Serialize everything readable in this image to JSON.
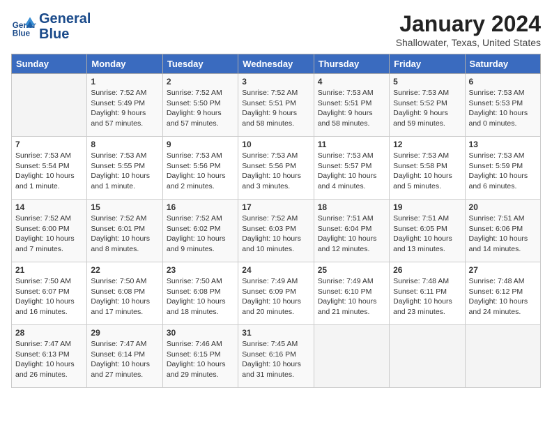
{
  "header": {
    "logo_line1": "General",
    "logo_line2": "Blue",
    "month": "January 2024",
    "location": "Shallowater, Texas, United States"
  },
  "days_of_week": [
    "Sunday",
    "Monday",
    "Tuesday",
    "Wednesday",
    "Thursday",
    "Friday",
    "Saturday"
  ],
  "weeks": [
    [
      {
        "day": "",
        "info": ""
      },
      {
        "day": "1",
        "info": "Sunrise: 7:52 AM\nSunset: 5:49 PM\nDaylight: 9 hours\nand 57 minutes."
      },
      {
        "day": "2",
        "info": "Sunrise: 7:52 AM\nSunset: 5:50 PM\nDaylight: 9 hours\nand 57 minutes."
      },
      {
        "day": "3",
        "info": "Sunrise: 7:52 AM\nSunset: 5:51 PM\nDaylight: 9 hours\nand 58 minutes."
      },
      {
        "day": "4",
        "info": "Sunrise: 7:53 AM\nSunset: 5:51 PM\nDaylight: 9 hours\nand 58 minutes."
      },
      {
        "day": "5",
        "info": "Sunrise: 7:53 AM\nSunset: 5:52 PM\nDaylight: 9 hours\nand 59 minutes."
      },
      {
        "day": "6",
        "info": "Sunrise: 7:53 AM\nSunset: 5:53 PM\nDaylight: 10 hours\nand 0 minutes."
      }
    ],
    [
      {
        "day": "7",
        "info": "Sunrise: 7:53 AM\nSunset: 5:54 PM\nDaylight: 10 hours\nand 1 minute."
      },
      {
        "day": "8",
        "info": "Sunrise: 7:53 AM\nSunset: 5:55 PM\nDaylight: 10 hours\nand 1 minute."
      },
      {
        "day": "9",
        "info": "Sunrise: 7:53 AM\nSunset: 5:56 PM\nDaylight: 10 hours\nand 2 minutes."
      },
      {
        "day": "10",
        "info": "Sunrise: 7:53 AM\nSunset: 5:56 PM\nDaylight: 10 hours\nand 3 minutes."
      },
      {
        "day": "11",
        "info": "Sunrise: 7:53 AM\nSunset: 5:57 PM\nDaylight: 10 hours\nand 4 minutes."
      },
      {
        "day": "12",
        "info": "Sunrise: 7:53 AM\nSunset: 5:58 PM\nDaylight: 10 hours\nand 5 minutes."
      },
      {
        "day": "13",
        "info": "Sunrise: 7:53 AM\nSunset: 5:59 PM\nDaylight: 10 hours\nand 6 minutes."
      }
    ],
    [
      {
        "day": "14",
        "info": "Sunrise: 7:52 AM\nSunset: 6:00 PM\nDaylight: 10 hours\nand 7 minutes."
      },
      {
        "day": "15",
        "info": "Sunrise: 7:52 AM\nSunset: 6:01 PM\nDaylight: 10 hours\nand 8 minutes."
      },
      {
        "day": "16",
        "info": "Sunrise: 7:52 AM\nSunset: 6:02 PM\nDaylight: 10 hours\nand 9 minutes."
      },
      {
        "day": "17",
        "info": "Sunrise: 7:52 AM\nSunset: 6:03 PM\nDaylight: 10 hours\nand 10 minutes."
      },
      {
        "day": "18",
        "info": "Sunrise: 7:51 AM\nSunset: 6:04 PM\nDaylight: 10 hours\nand 12 minutes."
      },
      {
        "day": "19",
        "info": "Sunrise: 7:51 AM\nSunset: 6:05 PM\nDaylight: 10 hours\nand 13 minutes."
      },
      {
        "day": "20",
        "info": "Sunrise: 7:51 AM\nSunset: 6:06 PM\nDaylight: 10 hours\nand 14 minutes."
      }
    ],
    [
      {
        "day": "21",
        "info": "Sunrise: 7:50 AM\nSunset: 6:07 PM\nDaylight: 10 hours\nand 16 minutes."
      },
      {
        "day": "22",
        "info": "Sunrise: 7:50 AM\nSunset: 6:08 PM\nDaylight: 10 hours\nand 17 minutes."
      },
      {
        "day": "23",
        "info": "Sunrise: 7:50 AM\nSunset: 6:08 PM\nDaylight: 10 hours\nand 18 minutes."
      },
      {
        "day": "24",
        "info": "Sunrise: 7:49 AM\nSunset: 6:09 PM\nDaylight: 10 hours\nand 20 minutes."
      },
      {
        "day": "25",
        "info": "Sunrise: 7:49 AM\nSunset: 6:10 PM\nDaylight: 10 hours\nand 21 minutes."
      },
      {
        "day": "26",
        "info": "Sunrise: 7:48 AM\nSunset: 6:11 PM\nDaylight: 10 hours\nand 23 minutes."
      },
      {
        "day": "27",
        "info": "Sunrise: 7:48 AM\nSunset: 6:12 PM\nDaylight: 10 hours\nand 24 minutes."
      }
    ],
    [
      {
        "day": "28",
        "info": "Sunrise: 7:47 AM\nSunset: 6:13 PM\nDaylight: 10 hours\nand 26 minutes."
      },
      {
        "day": "29",
        "info": "Sunrise: 7:47 AM\nSunset: 6:14 PM\nDaylight: 10 hours\nand 27 minutes."
      },
      {
        "day": "30",
        "info": "Sunrise: 7:46 AM\nSunset: 6:15 PM\nDaylight: 10 hours\nand 29 minutes."
      },
      {
        "day": "31",
        "info": "Sunrise: 7:45 AM\nSunset: 6:16 PM\nDaylight: 10 hours\nand 31 minutes."
      },
      {
        "day": "",
        "info": ""
      },
      {
        "day": "",
        "info": ""
      },
      {
        "day": "",
        "info": ""
      }
    ]
  ]
}
